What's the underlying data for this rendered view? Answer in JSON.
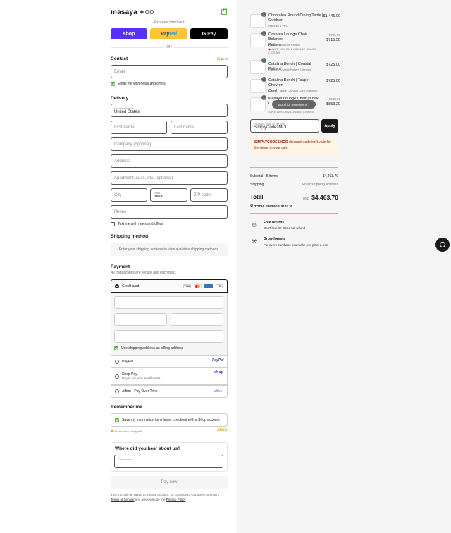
{
  "brand": {
    "name": "masaya",
    "star": "✱",
    "suffix": "OO"
  },
  "express": {
    "label": "Express checkout",
    "shop": "shop",
    "paypal_a": "Pay",
    "paypal_b": "Pal",
    "gpay_g": "G",
    "gpay_text": "Pay",
    "or": "OR"
  },
  "contact": {
    "heading": "Contact",
    "sign_in": "Sign in",
    "email_placeholder": "Email",
    "news_label": "Email me with news and offers"
  },
  "delivery": {
    "heading": "Delivery",
    "country_label": "Country/Region",
    "country_value": "United States",
    "first_name": "First name",
    "last_name": "Last name",
    "company": "Company (optional)",
    "address": "Address",
    "apartment": "Apartment, suite, etc. (optional)",
    "city": "City",
    "state_label": "State",
    "state_value": "Iowa",
    "zip": "ZIP code",
    "phone": "Phone",
    "text_label": "Text me with news and offers"
  },
  "shipping": {
    "heading": "Shipping method",
    "message": "Enter your shipping address to view available shipping methods."
  },
  "payment": {
    "heading": "Payment",
    "subtitle": "All transactions are secure and encrypted.",
    "credit_card": "Credit card",
    "visa": "VISA",
    "more": "+5",
    "billing_label": "Use shipping address as billing address",
    "paypal": "PayPal",
    "paypal_logo": "PayPal",
    "shop_pay": "Shop Pay",
    "shop_pay_sub": "Pay in full or in installments",
    "shop_pay_logo": "shop",
    "affirm": "Affirm - Pay Over Time",
    "affirm_logo": "affirm"
  },
  "remember": {
    "heading": "Remember me",
    "label": "Save my information for a faster checkout with a Shop account",
    "secure": "Secure and encrypted",
    "shop_logo": "shop"
  },
  "survey": {
    "heading": "Where did you hear about us?",
    "placeholder": "Choose one"
  },
  "pay_now": "Pay now",
  "legal": {
    "text1": "Your info will be saved to a Shop account. By continuing, you agree to Shop's",
    "tos": "Terms of Service",
    "and": "and acknowledge the",
    "privacy": "Privacy Policy",
    "dot": "."
  },
  "cart": {
    "items": [
      {
        "qty": "1",
        "name_l1": "Chontalea Round Dining Table |",
        "name_l2": "Outdoor",
        "variant": "Natural / 4 PPL",
        "price": "$1,445.00",
        "old_price": "",
        "promo": ""
      },
      {
        "qty": "1",
        "name_l1": "Casares Lounge Chair | Balance",
        "name_l2": "Pattern",
        "variant": "Natural / Balance Pattern",
        "price": "$715.50",
        "old_price": "$795.00",
        "promo": "SAVE 10% ON 2 LOUNGE CHAIRS (-$79.50)"
      },
      {
        "qty": "1",
        "name_l1": "Catalina Bench | Coastal Pattern",
        "name_l2": "",
        "variant": "Natural / Coastal Pattern / Medium",
        "price": "$725.00",
        "old_price": "",
        "promo": ""
      },
      {
        "qty": "1",
        "name_l1": "Catalina Bench | Taupe Chevron",
        "name_l2": "Cord",
        "variant": "Coffee / Taupe Chevron Cord / Medium",
        "price": "$725.00",
        "old_price": "",
        "promo": ""
      },
      {
        "qty": "1",
        "name_l1": "Masaya Lounge Chair | Khaki",
        "name_l2": "C",
        "variant": "",
        "price": "$853.20",
        "old_price": "$948.00",
        "promo": "SAVE 10% ON 2 LOUNGE CHAIRS"
      }
    ],
    "scroll_hint": "Scroll for more items ↓"
  },
  "discount": {
    "label": "Discount code or gift card",
    "value": "SimplyCodesMCO",
    "apply": "Apply",
    "error_code": "SIMPLYCODESMCO",
    "error_text": "discount code isn't valid for the items in your cart"
  },
  "summary": {
    "subtotal_label": "Subtotal · 5 items",
    "subtotal_value": "$4,463.70",
    "shipping_label": "Shipping",
    "shipping_value": "Enter shipping address",
    "total_label": "Total",
    "currency": "USD",
    "total_value": "$4,463.70",
    "savings_label": "TOTAL SAVINGS",
    "savings_value": "$174.30"
  },
  "perks": [
    {
      "title": "Free returns",
      "text": "Don't love it? Get a full refund"
    },
    {
      "title": "Grow forests",
      "text": "For every purchase you make, we plant a tree"
    }
  ],
  "colors": {
    "accent": "#5fb04a",
    "shop": "#5a31f4",
    "paypal": "#ffc439"
  }
}
